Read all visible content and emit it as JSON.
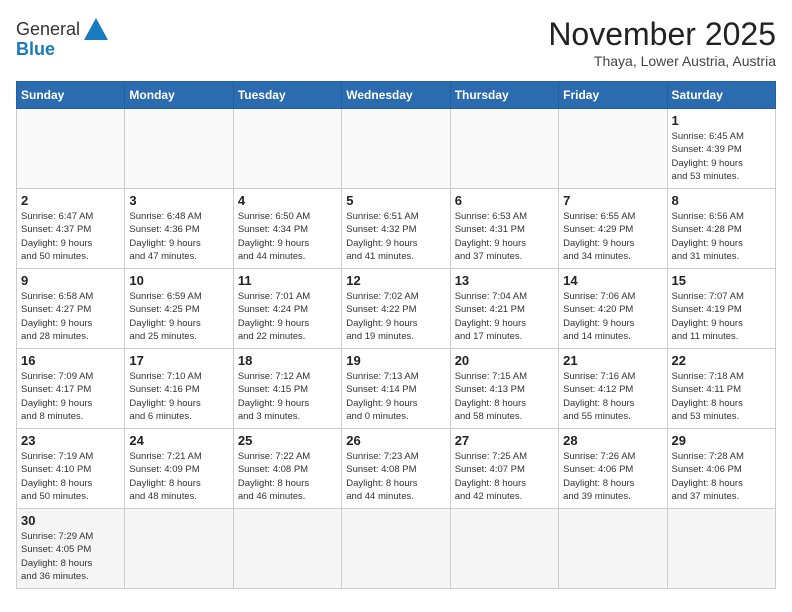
{
  "header": {
    "logo_general": "General",
    "logo_blue": "Blue",
    "title": "November 2025",
    "subtitle": "Thaya, Lower Austria, Austria"
  },
  "weekdays": [
    "Sunday",
    "Monday",
    "Tuesday",
    "Wednesday",
    "Thursday",
    "Friday",
    "Saturday"
  ],
  "days": [
    {
      "day": "",
      "info": ""
    },
    {
      "day": "",
      "info": ""
    },
    {
      "day": "",
      "info": ""
    },
    {
      "day": "",
      "info": ""
    },
    {
      "day": "",
      "info": ""
    },
    {
      "day": "",
      "info": ""
    },
    {
      "day": "1",
      "info": "Sunrise: 6:45 AM\nSunset: 4:39 PM\nDaylight: 9 hours\nand 53 minutes."
    },
    {
      "day": "2",
      "info": "Sunrise: 6:47 AM\nSunset: 4:37 PM\nDaylight: 9 hours\nand 50 minutes."
    },
    {
      "day": "3",
      "info": "Sunrise: 6:48 AM\nSunset: 4:36 PM\nDaylight: 9 hours\nand 47 minutes."
    },
    {
      "day": "4",
      "info": "Sunrise: 6:50 AM\nSunset: 4:34 PM\nDaylight: 9 hours\nand 44 minutes."
    },
    {
      "day": "5",
      "info": "Sunrise: 6:51 AM\nSunset: 4:32 PM\nDaylight: 9 hours\nand 41 minutes."
    },
    {
      "day": "6",
      "info": "Sunrise: 6:53 AM\nSunset: 4:31 PM\nDaylight: 9 hours\nand 37 minutes."
    },
    {
      "day": "7",
      "info": "Sunrise: 6:55 AM\nSunset: 4:29 PM\nDaylight: 9 hours\nand 34 minutes."
    },
    {
      "day": "8",
      "info": "Sunrise: 6:56 AM\nSunset: 4:28 PM\nDaylight: 9 hours\nand 31 minutes."
    },
    {
      "day": "9",
      "info": "Sunrise: 6:58 AM\nSunset: 4:27 PM\nDaylight: 9 hours\nand 28 minutes."
    },
    {
      "day": "10",
      "info": "Sunrise: 6:59 AM\nSunset: 4:25 PM\nDaylight: 9 hours\nand 25 minutes."
    },
    {
      "day": "11",
      "info": "Sunrise: 7:01 AM\nSunset: 4:24 PM\nDaylight: 9 hours\nand 22 minutes."
    },
    {
      "day": "12",
      "info": "Sunrise: 7:02 AM\nSunset: 4:22 PM\nDaylight: 9 hours\nand 19 minutes."
    },
    {
      "day": "13",
      "info": "Sunrise: 7:04 AM\nSunset: 4:21 PM\nDaylight: 9 hours\nand 17 minutes."
    },
    {
      "day": "14",
      "info": "Sunrise: 7:06 AM\nSunset: 4:20 PM\nDaylight: 9 hours\nand 14 minutes."
    },
    {
      "day": "15",
      "info": "Sunrise: 7:07 AM\nSunset: 4:19 PM\nDaylight: 9 hours\nand 11 minutes."
    },
    {
      "day": "16",
      "info": "Sunrise: 7:09 AM\nSunset: 4:17 PM\nDaylight: 9 hours\nand 8 minutes."
    },
    {
      "day": "17",
      "info": "Sunrise: 7:10 AM\nSunset: 4:16 PM\nDaylight: 9 hours\nand 6 minutes."
    },
    {
      "day": "18",
      "info": "Sunrise: 7:12 AM\nSunset: 4:15 PM\nDaylight: 9 hours\nand 3 minutes."
    },
    {
      "day": "19",
      "info": "Sunrise: 7:13 AM\nSunset: 4:14 PM\nDaylight: 9 hours\nand 0 minutes."
    },
    {
      "day": "20",
      "info": "Sunrise: 7:15 AM\nSunset: 4:13 PM\nDaylight: 8 hours\nand 58 minutes."
    },
    {
      "day": "21",
      "info": "Sunrise: 7:16 AM\nSunset: 4:12 PM\nDaylight: 8 hours\nand 55 minutes."
    },
    {
      "day": "22",
      "info": "Sunrise: 7:18 AM\nSunset: 4:11 PM\nDaylight: 8 hours\nand 53 minutes."
    },
    {
      "day": "23",
      "info": "Sunrise: 7:19 AM\nSunset: 4:10 PM\nDaylight: 8 hours\nand 50 minutes."
    },
    {
      "day": "24",
      "info": "Sunrise: 7:21 AM\nSunset: 4:09 PM\nDaylight: 8 hours\nand 48 minutes."
    },
    {
      "day": "25",
      "info": "Sunrise: 7:22 AM\nSunset: 4:08 PM\nDaylight: 8 hours\nand 46 minutes."
    },
    {
      "day": "26",
      "info": "Sunrise: 7:23 AM\nSunset: 4:08 PM\nDaylight: 8 hours\nand 44 minutes."
    },
    {
      "day": "27",
      "info": "Sunrise: 7:25 AM\nSunset: 4:07 PM\nDaylight: 8 hours\nand 42 minutes."
    },
    {
      "day": "28",
      "info": "Sunrise: 7:26 AM\nSunset: 4:06 PM\nDaylight: 8 hours\nand 39 minutes."
    },
    {
      "day": "29",
      "info": "Sunrise: 7:28 AM\nSunset: 4:06 PM\nDaylight: 8 hours\nand 37 minutes."
    },
    {
      "day": "30",
      "info": "Sunrise: 7:29 AM\nSunset: 4:05 PM\nDaylight: 8 hours\nand 36 minutes."
    },
    {
      "day": "",
      "info": ""
    },
    {
      "day": "",
      "info": ""
    },
    {
      "day": "",
      "info": ""
    },
    {
      "day": "",
      "info": ""
    },
    {
      "day": "",
      "info": ""
    },
    {
      "day": "",
      "info": ""
    }
  ]
}
